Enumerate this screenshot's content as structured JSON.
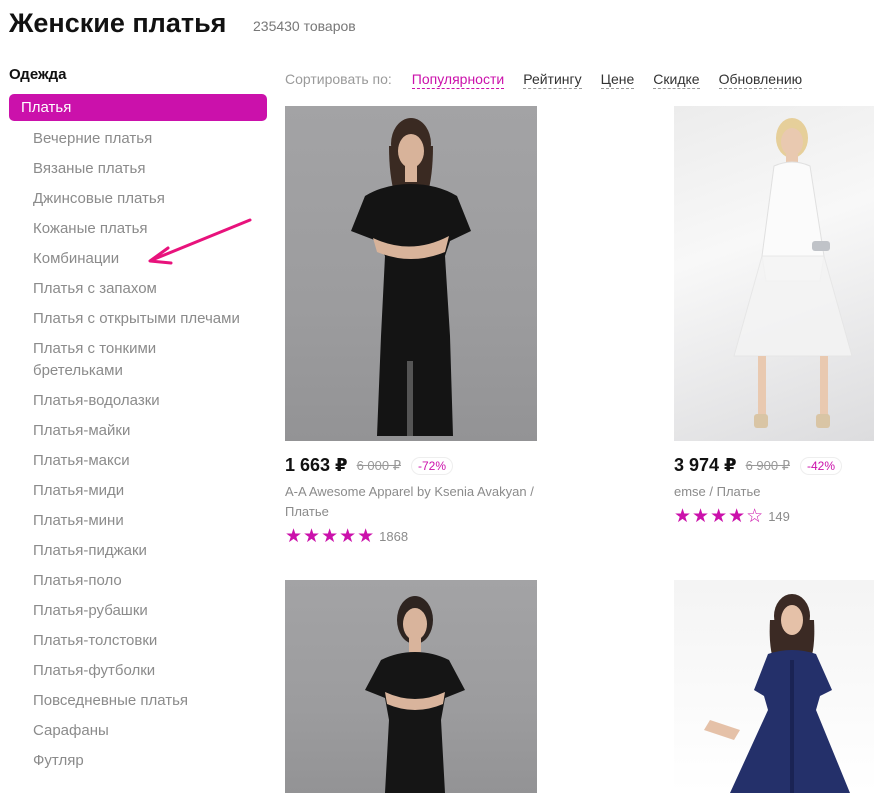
{
  "header": {
    "title": "Женские платья",
    "count": "235430 товаров"
  },
  "sidebar": {
    "heading": "Одежда",
    "active_item": "Платья",
    "items": [
      "Вечерние платья",
      "Вязаные платья",
      "Джинсовые платья",
      "Кожаные платья",
      "Комбинации",
      "Платья с запахом",
      "Платья с открытыми плечами",
      "Платья с тонкими бретельками",
      "Платья-водолазки",
      "Платья-майки",
      "Платья-макси",
      "Платья-миди",
      "Платья-мини",
      "Платья-пиджаки",
      "Платья-поло",
      "Платья-рубашки",
      "Платья-толстовки",
      "Платья-футболки",
      "Повседневные платья",
      "Сарафаны",
      "Футляр"
    ]
  },
  "sort": {
    "label": "Сортировать по:",
    "options": [
      "Популярности",
      "Рейтингу",
      "Цене",
      "Скидке",
      "Обновлению"
    ],
    "active": "Популярности"
  },
  "products": [
    {
      "price": "1 663 ₽",
      "old_price": "6 000 ₽",
      "discount": "-72%",
      "brand": "A-A Awesome Apparel by Ksenia Avakyan / Платье",
      "stars": "★★★★★",
      "reviews": "1868"
    },
    {
      "price": "3 974 ₽",
      "old_price": "6 900 ₽",
      "discount": "-42%",
      "brand": "emse / Платье",
      "stars": "★★★★",
      "stars_empty": "☆",
      "reviews": "149"
    }
  ],
  "colors": {
    "accent": "#cb11ab"
  },
  "icons": {
    "annotation": "arrow-icon",
    "star": "star-icon"
  }
}
